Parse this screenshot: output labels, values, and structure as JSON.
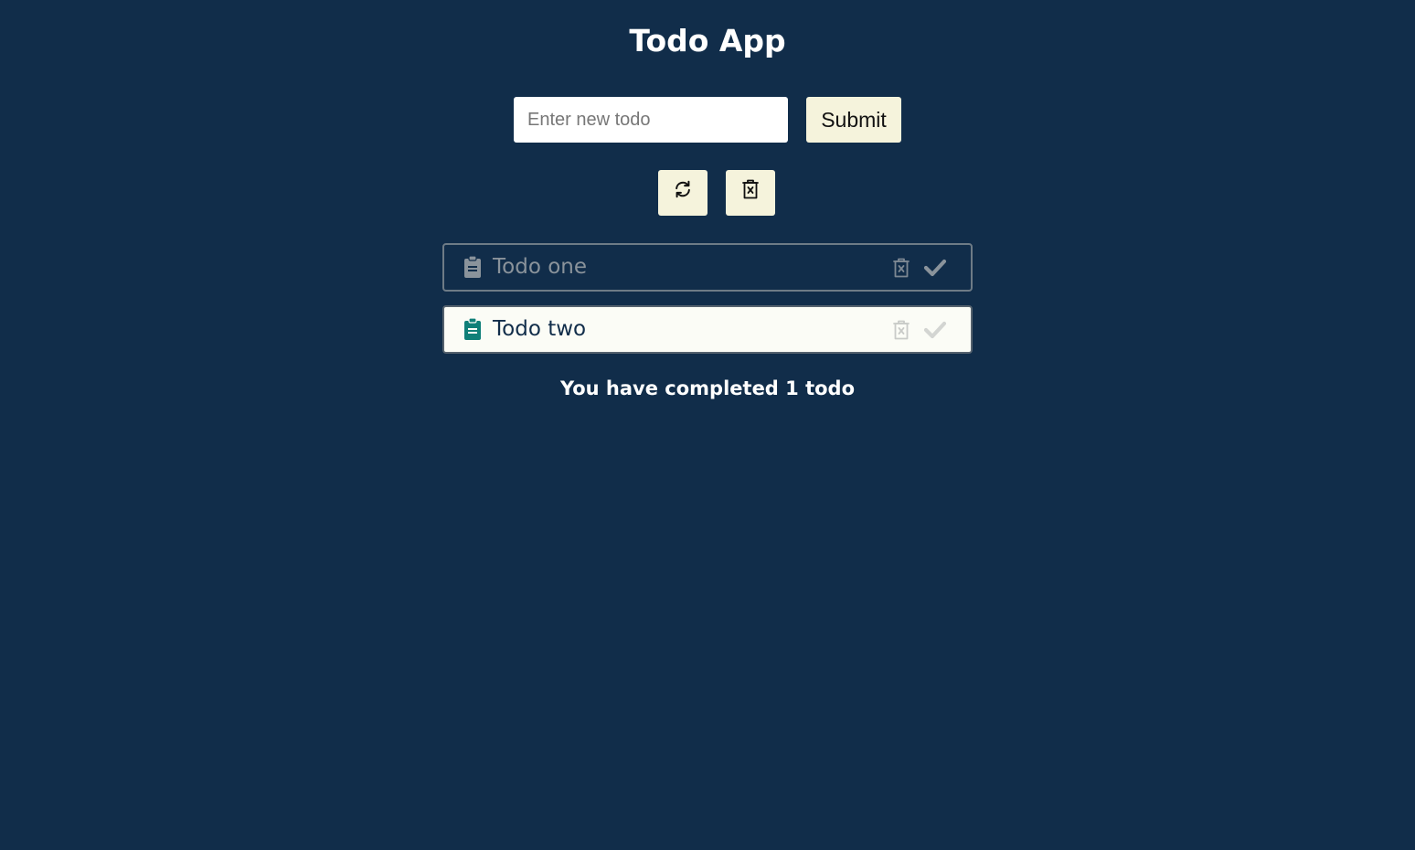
{
  "app": {
    "title": "Todo App"
  },
  "form": {
    "input_value": "",
    "input_placeholder": "Enter new todo",
    "submit_label": "Submit"
  },
  "actions": {
    "refresh_icon": "refresh-icon",
    "clear_all_icon": "trash-x-icon"
  },
  "todos": [
    {
      "text": "Todo one",
      "completed": true,
      "icon": "clipboard-icon"
    },
    {
      "text": "Todo two",
      "completed": false,
      "icon": "clipboard-icon"
    }
  ],
  "status": {
    "text": "You have completed 1 todo"
  },
  "colors": {
    "background": "#112d4a",
    "button_bg": "#f5f3dc",
    "accent_teal": "#0f7f78",
    "completed_text": "#8a939b",
    "pending_bg": "#fbfcf6"
  }
}
